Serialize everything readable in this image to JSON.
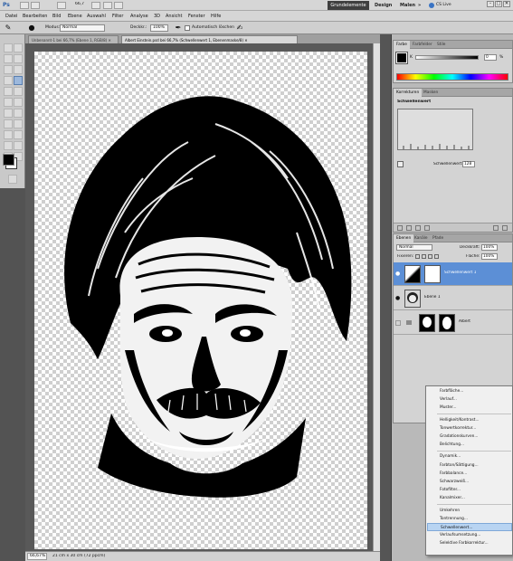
{
  "app": {
    "logo": "Ps",
    "zoom_widget": "66,7",
    "workspaces": [
      "Grundelemente",
      "Design",
      "Malen"
    ],
    "more": "»",
    "cs_live": "CS Live",
    "window_buttons": [
      "–",
      "□",
      "✕"
    ]
  },
  "menu": [
    "Datei",
    "Bearbeiten",
    "Bild",
    "Ebene",
    "Auswahl",
    "Filter",
    "Analyse",
    "3D",
    "Ansicht",
    "Fenster",
    "Hilfe"
  ],
  "options": {
    "mode_label": "Modus:",
    "mode_value": "Normal",
    "opacity_label": "Deckkr.:",
    "opacity_value": "100%",
    "auto_erase_label": "Automatisch löschen"
  },
  "tabs": [
    {
      "label": "Unbenannt-1 bei 66,7% (Ebene 1, RGB/8) ✕",
      "active": false
    },
    {
      "label": "Albert Einstein.psd bei 66,7% (Schwellenwert 1, Ebenenmaske/8) ✕",
      "active": true
    }
  ],
  "status": {
    "zoom": "66,67%",
    "doc_info": "21 cm x 30 cm (72 ppcm)"
  },
  "color_panel": {
    "tabs": [
      "Farbe",
      "Farbfelder",
      "Stile"
    ],
    "channel": "K",
    "value": "0",
    "unit": "%"
  },
  "adjust_panel": {
    "tabs": [
      "Korrekturen",
      "Masken"
    ],
    "title": "Schwellenwert",
    "threshold_label": "Schwellenwert:",
    "threshold_value": "128"
  },
  "layers_panel": {
    "tabs": [
      "Ebenen",
      "Kanäle",
      "Pfade"
    ],
    "blend_mode": "Normal",
    "opacity_label": "Deckkraft:",
    "opacity_value": "100%",
    "lock_label": "Fixieren:",
    "fill_label": "Fläche:",
    "fill_value": "100%",
    "layers": [
      {
        "name": "Schwellenwert 1",
        "selected": true
      },
      {
        "name": "Ebene 1",
        "selected": false
      },
      {
        "name": "Albert",
        "selected": false
      }
    ]
  },
  "context_menu": {
    "groups": [
      [
        "Farbfläche...",
        "Verlauf...",
        "Muster..."
      ],
      [
        "Helligkeit/Kontrast...",
        "Tonwertkorrektur...",
        "Gradationskurven...",
        "Belichtung..."
      ],
      [
        "Dynamik...",
        "Farbton/Sättigung...",
        "Farbbalance...",
        "Schwarzweiß...",
        "Fotofilter...",
        "Kanalmixer..."
      ],
      [
        "Umkehren",
        "Tontrennung...",
        "Schwellenwert...",
        "Verlaufsumsetzung...",
        "Selektive Farbkorrektur..."
      ]
    ],
    "highlighted": "Schwellenwert..."
  }
}
